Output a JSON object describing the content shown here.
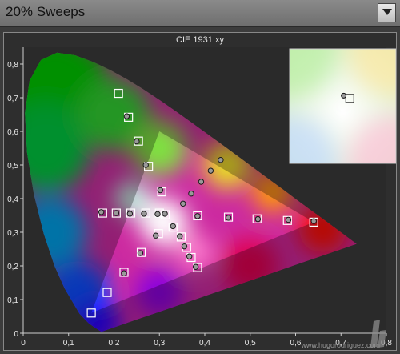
{
  "header": {
    "title": "20% Sweeps"
  },
  "chart_data": {
    "type": "scatter",
    "title": "CIE 1931 xy",
    "xlim": [
      0,
      0.8
    ],
    "ylim": [
      0,
      0.85
    ],
    "x_ticks": [
      0,
      0.1,
      0.2,
      0.3,
      0.4,
      0.5,
      0.6,
      0.7,
      0.8
    ],
    "x_tick_labels": [
      "0",
      "0,1",
      "0,2",
      "0,3",
      "0,4",
      "0,5",
      "0,6",
      "0,7",
      "0,8"
    ],
    "y_ticks": [
      0,
      0.1,
      0.2,
      0.3,
      0.4,
      0.5,
      0.6,
      0.7,
      0.8
    ],
    "y_tick_labels": [
      "0",
      "0,1",
      "0,2",
      "0,3",
      "0,4",
      "0,5",
      "0,6",
      "0,7",
      "0,8"
    ],
    "grid": false,
    "background_color": "#2a2a2a",
    "white_point": {
      "x": 0.3127,
      "y": 0.329
    },
    "gamut_triangle": [
      {
        "x": 0.64,
        "y": 0.33
      },
      {
        "x": 0.3,
        "y": 0.6
      },
      {
        "x": 0.15,
        "y": 0.06
      }
    ],
    "targets": [
      {
        "x": 0.313,
        "y": 0.352
      },
      {
        "x": 0.21,
        "y": 0.713
      },
      {
        "x": 0.232,
        "y": 0.642
      },
      {
        "x": 0.254,
        "y": 0.571
      },
      {
        "x": 0.276,
        "y": 0.496
      },
      {
        "x": 0.15,
        "y": 0.06
      },
      {
        "x": 0.185,
        "y": 0.121
      },
      {
        "x": 0.222,
        "y": 0.181
      },
      {
        "x": 0.26,
        "y": 0.24
      },
      {
        "x": 0.298,
        "y": 0.296
      },
      {
        "x": 0.64,
        "y": 0.33
      },
      {
        "x": 0.582,
        "y": 0.335
      },
      {
        "x": 0.515,
        "y": 0.34
      },
      {
        "x": 0.452,
        "y": 0.345
      },
      {
        "x": 0.384,
        "y": 0.349
      },
      {
        "x": 0.175,
        "y": 0.357
      },
      {
        "x": 0.205,
        "y": 0.357
      },
      {
        "x": 0.237,
        "y": 0.357
      },
      {
        "x": 0.27,
        "y": 0.357
      },
      {
        "x": 0.3,
        "y": 0.357
      },
      {
        "x": 0.384,
        "y": 0.195
      },
      {
        "x": 0.37,
        "y": 0.225
      },
      {
        "x": 0.36,
        "y": 0.255
      },
      {
        "x": 0.348,
        "y": 0.286
      },
      {
        "x": 0.33,
        "y": 0.315
      },
      {
        "x": 0.305,
        "y": 0.42
      }
    ],
    "measurements": [
      {
        "x": 0.312,
        "y": 0.355
      },
      {
        "x": 0.228,
        "y": 0.645
      },
      {
        "x": 0.25,
        "y": 0.57
      },
      {
        "x": 0.27,
        "y": 0.5
      },
      {
        "x": 0.302,
        "y": 0.425
      },
      {
        "x": 0.222,
        "y": 0.178
      },
      {
        "x": 0.258,
        "y": 0.238
      },
      {
        "x": 0.292,
        "y": 0.29
      },
      {
        "x": 0.33,
        "y": 0.318
      },
      {
        "x": 0.345,
        "y": 0.288
      },
      {
        "x": 0.355,
        "y": 0.258
      },
      {
        "x": 0.366,
        "y": 0.228
      },
      {
        "x": 0.38,
        "y": 0.197
      },
      {
        "x": 0.172,
        "y": 0.36
      },
      {
        "x": 0.205,
        "y": 0.357
      },
      {
        "x": 0.235,
        "y": 0.355
      },
      {
        "x": 0.266,
        "y": 0.355
      },
      {
        "x": 0.296,
        "y": 0.354
      },
      {
        "x": 0.384,
        "y": 0.348
      },
      {
        "x": 0.452,
        "y": 0.343
      },
      {
        "x": 0.517,
        "y": 0.339
      },
      {
        "x": 0.584,
        "y": 0.337
      },
      {
        "x": 0.64,
        "y": 0.333
      },
      {
        "x": 0.352,
        "y": 0.385
      },
      {
        "x": 0.37,
        "y": 0.415
      },
      {
        "x": 0.392,
        "y": 0.45
      },
      {
        "x": 0.413,
        "y": 0.483
      },
      {
        "x": 0.435,
        "y": 0.515
      }
    ],
    "zoom_inset": {
      "center": {
        "x": 0.3127,
        "y": 0.329
      },
      "target_point": {
        "x": 0.3135,
        "y": 0.3298
      },
      "measured_point": {
        "x": 0.3128,
        "y": 0.3301
      }
    }
  },
  "watermark": "www.hugorodriguez.com"
}
